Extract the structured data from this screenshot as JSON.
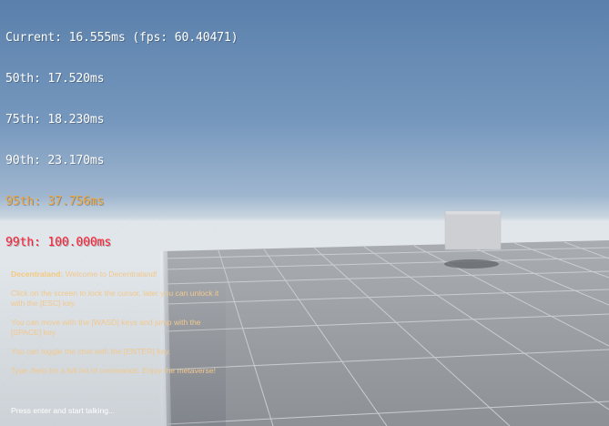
{
  "colors": {
    "stat_normal": "#ffffff",
    "stat_warning": "#f2a63a",
    "stat_critical": "#ff2036",
    "chat_sender": "#f5c97e",
    "chat_text": "#f2c88c",
    "chat_placeholder": "#ffffff"
  },
  "stats": {
    "current": "Current: 16.555ms (fps: 60.40471)",
    "p50": "50th: 17.520ms",
    "p75": "75th: 18.230ms",
    "p90": "90th: 23.170ms",
    "p95": "95th: 37.756ms",
    "p99": "99th: 100.000ms"
  },
  "chat": {
    "welcome_sender": "Decentraland:",
    "welcome_text": " Welcome to Decentraland!",
    "messages": [
      "Click on the screen to lock the cursor, later you can unlock it with the [ESC] key.",
      "You can move with the [WASD] keys and jump with the [SPACE] key.",
      "You can toggle the chat with the [ENTER] key.",
      "Type /help for a full list of commands. Enjoy the metaverse!"
    ],
    "input_placeholder": "Press enter and start talking..."
  }
}
